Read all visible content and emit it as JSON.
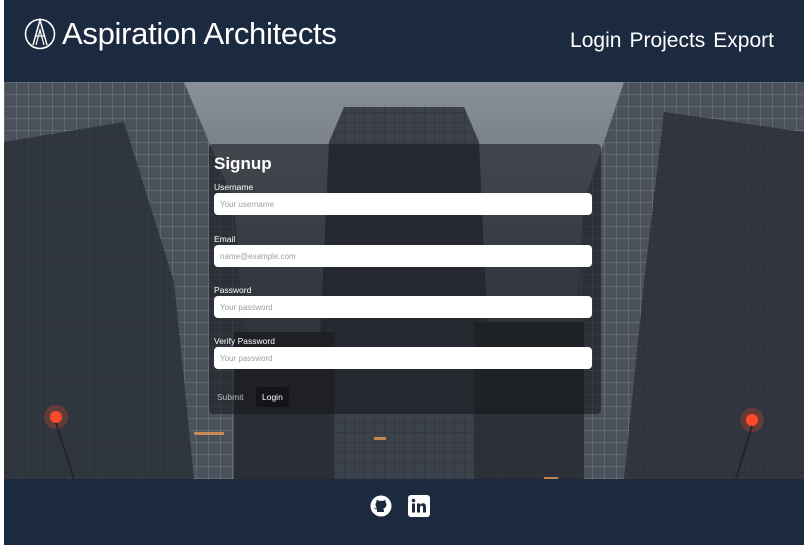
{
  "header": {
    "brand": "Aspiration Architects",
    "logo_icon": "aa-monogram-icon",
    "nav": [
      {
        "label": "Login"
      },
      {
        "label": "Projects"
      },
      {
        "label": "Export"
      }
    ]
  },
  "signup": {
    "title": "Signup",
    "fields": [
      {
        "label": "Username",
        "placeholder": "Your username",
        "value": ""
      },
      {
        "label": "Email",
        "placeholder": "name@example.com",
        "value": ""
      },
      {
        "label": "Password",
        "placeholder": "Your password",
        "value": ""
      },
      {
        "label": "Verify Password",
        "placeholder": "Your password",
        "value": ""
      }
    ],
    "submit_label": "Submit",
    "login_label": "Login"
  },
  "footer": {
    "icons": [
      "github-icon",
      "linkedin-icon"
    ]
  },
  "colors": {
    "navy": "#1c2a40",
    "white": "#ffffff",
    "card_overlay": "rgba(20,22,26,0.55)"
  }
}
